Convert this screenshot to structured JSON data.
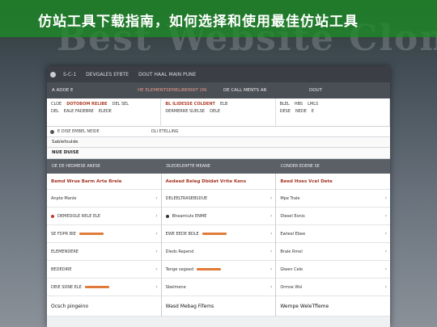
{
  "banner": {
    "title": "仿站工具下载指南，如何选择和使用最佳仿站工具"
  },
  "background": {
    "ghost_text": "Best Website Clone Tools"
  },
  "app": {
    "topbar": {
      "items": [
        "S-C-1",
        "DEVGALES EFBTE",
        "DOUT HAAL MAIN PUNE"
      ]
    },
    "subbar": {
      "cells": [
        "A ADOE E",
        "HE ELEMENTSEMELIBERNIT ON",
        "DE CALL MENTS AR",
        "DOUT"
      ]
    },
    "info": {
      "cols": [
        {
          "rows": [
            [
              "CLOE",
              "DOTOBOM RELIBE",
              "DEL SEL"
            ],
            [
              "DEL",
              "EALE FADEBRE",
              "ELEDE"
            ]
          ]
        },
        {
          "rows": [
            [
              "BL ILIDESSE COLDENT",
              "ELB"
            ],
            [
              "DERMERRE SUELSE",
              "DELE"
            ]
          ]
        },
        {
          "rows": [
            [
              "BLEL",
              "HBS",
              "LMLS"
            ],
            [
              "DESE",
              "NEDE",
              "E"
            ]
          ]
        }
      ]
    },
    "strip": {
      "left": "E DISE EMBEL NEIDE",
      "right": "DLI ETELLING"
    },
    "section1": "Sablefoulde",
    "section2": "NUE DUISE",
    "table_head": [
      "DE DE HEDMESE ANESE",
      "DLEDELERFTE MEANE",
      "CONDER EDENE SE"
    ],
    "columns": [
      {
        "head": "Bemd Wrue Barm Arte Brele",
        "rows": [
          "Anpte Manle",
          "DEMEDOLE RELE ELE",
          "SE FDPR BIE",
          "ELEMENDERE",
          "BEDEDIRE",
          "DEIE SDNE ELE"
        ],
        "foot": "Ocsch pingeino"
      },
      {
        "head": "Aedeed Beleg Dbidet Vrite Kens",
        "rows": [
          "DELEELTRASEBSDUE",
          "Bheamiuts ENME",
          "EWE EEDE BDLE",
          "Dleds Repend",
          "Tenge segeed",
          "Sbelmene"
        ],
        "foot": "Wasd Mebag Fifems"
      },
      {
        "head": "Beed Hoes Vcel Dete",
        "rows": [
          "Mpe Trale",
          "Dlesel Eonis",
          "Ewteel Ebee",
          "Brale Rmel",
          "Gteen Cele",
          "Ormse Wsl"
        ],
        "foot": "Wempe WeleTfleme"
      }
    ]
  }
}
